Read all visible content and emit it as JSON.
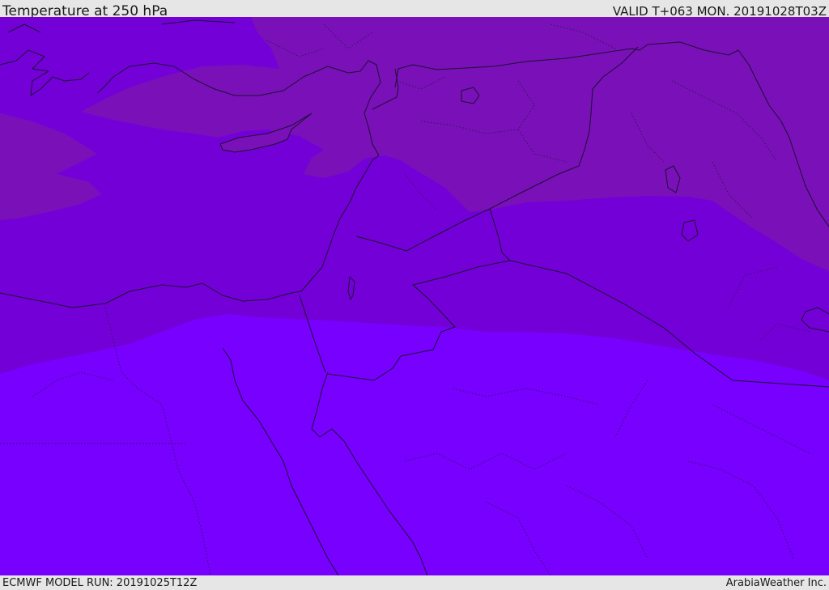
{
  "header": {
    "title": "Temperature at 250 hPa",
    "valid_time": "VALID T+063 MON. 20191028T03Z"
  },
  "footer": {
    "model_run": "ECMWF MODEL RUN: 20191025T12Z",
    "credit": "ArabiaWeather Inc."
  },
  "colors": {
    "band_north": "#7a10b8",
    "band_middle": "#7400d8",
    "band_south": "#7800fe",
    "lines": "#1a1030",
    "chrome": "#e6e6e6"
  }
}
